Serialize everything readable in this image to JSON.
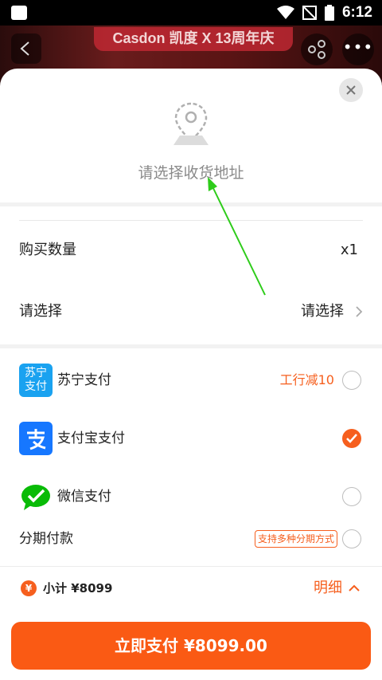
{
  "status_bar": {
    "time": "6:12"
  },
  "background": {
    "banner_text": "Casdon 凯度 X 13周年庆"
  },
  "address": {
    "placeholder": "请选择收货地址"
  },
  "quantity": {
    "label": "购买数量",
    "value": "x1"
  },
  "spec": {
    "label": "请选择",
    "value": "请选择"
  },
  "payment_methods": [
    {
      "label": "苏宁支付",
      "logo_text": "苏宁支付",
      "promo": "工行减10",
      "selected": false
    },
    {
      "label": "支付宝支付",
      "selected": true
    },
    {
      "label": "微信支付",
      "selected": false
    },
    {
      "label": "分期付款",
      "tag": "支持多种分期方式",
      "selected": false
    }
  ],
  "footer": {
    "yen_symbol": "¥",
    "subtotal": "小计 ¥8099",
    "detail_label": "明细",
    "pay_button": "立即支付 ¥8099.00"
  },
  "colors": {
    "accent": "#f65f1e",
    "button": "#fa5a14",
    "suning": "#1aa2f0",
    "alipay": "#1677ff",
    "wechat": "#09bb07"
  }
}
